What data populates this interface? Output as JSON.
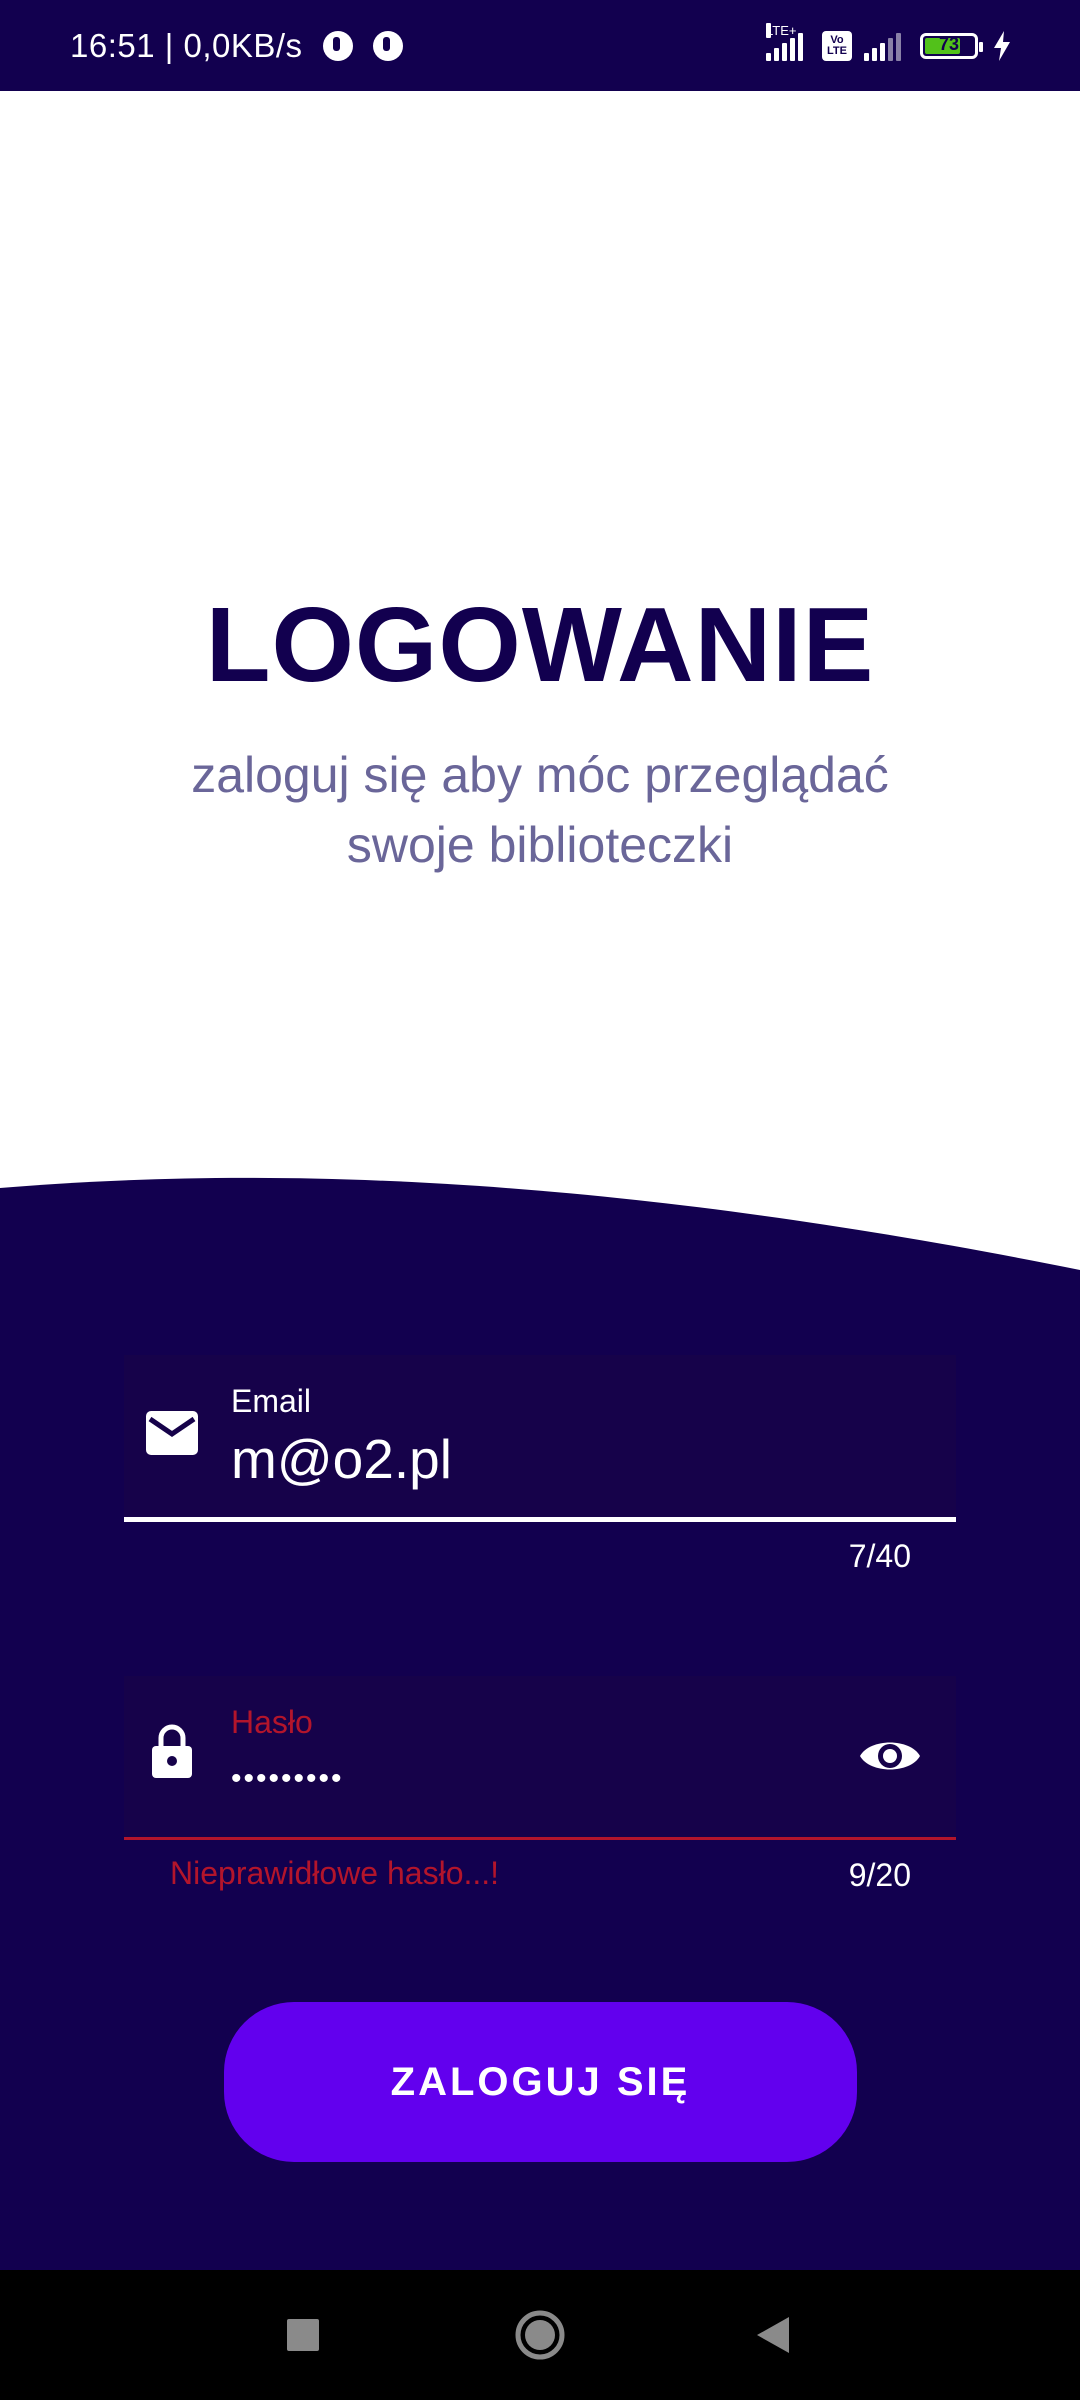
{
  "status_bar": {
    "time_speed": "16:51 | 0,0KB/s",
    "lte_label": "LTE+",
    "volte_label": "Vo LTE",
    "battery_level": "73",
    "battery_fraction": 0.73
  },
  "header": {
    "title": "LOGOWANIE",
    "subtitle": "zaloguj się aby móc przeglądać swoje biblioteczki"
  },
  "email_field": {
    "label": "Email",
    "value": "m@o2.pl",
    "counter": "7/40",
    "icon": "envelope-icon"
  },
  "password_field": {
    "label": "Hasło",
    "value_masked": "•••••••••",
    "counter": "9/20",
    "error": "Nieprawidłowe hasło...!",
    "icon": "lock-icon",
    "toggle_icon": "eye-icon"
  },
  "login_button": {
    "label": "ZALOGUJ SIĘ"
  },
  "nav_bar": {
    "items": [
      "recents-button",
      "home-button",
      "back-button"
    ]
  },
  "colors": {
    "dark_navy": "#12004f",
    "field_bg": "#16024a",
    "subtitle": "#6a6699",
    "error": "#b3152b",
    "button": "#6200ee"
  }
}
